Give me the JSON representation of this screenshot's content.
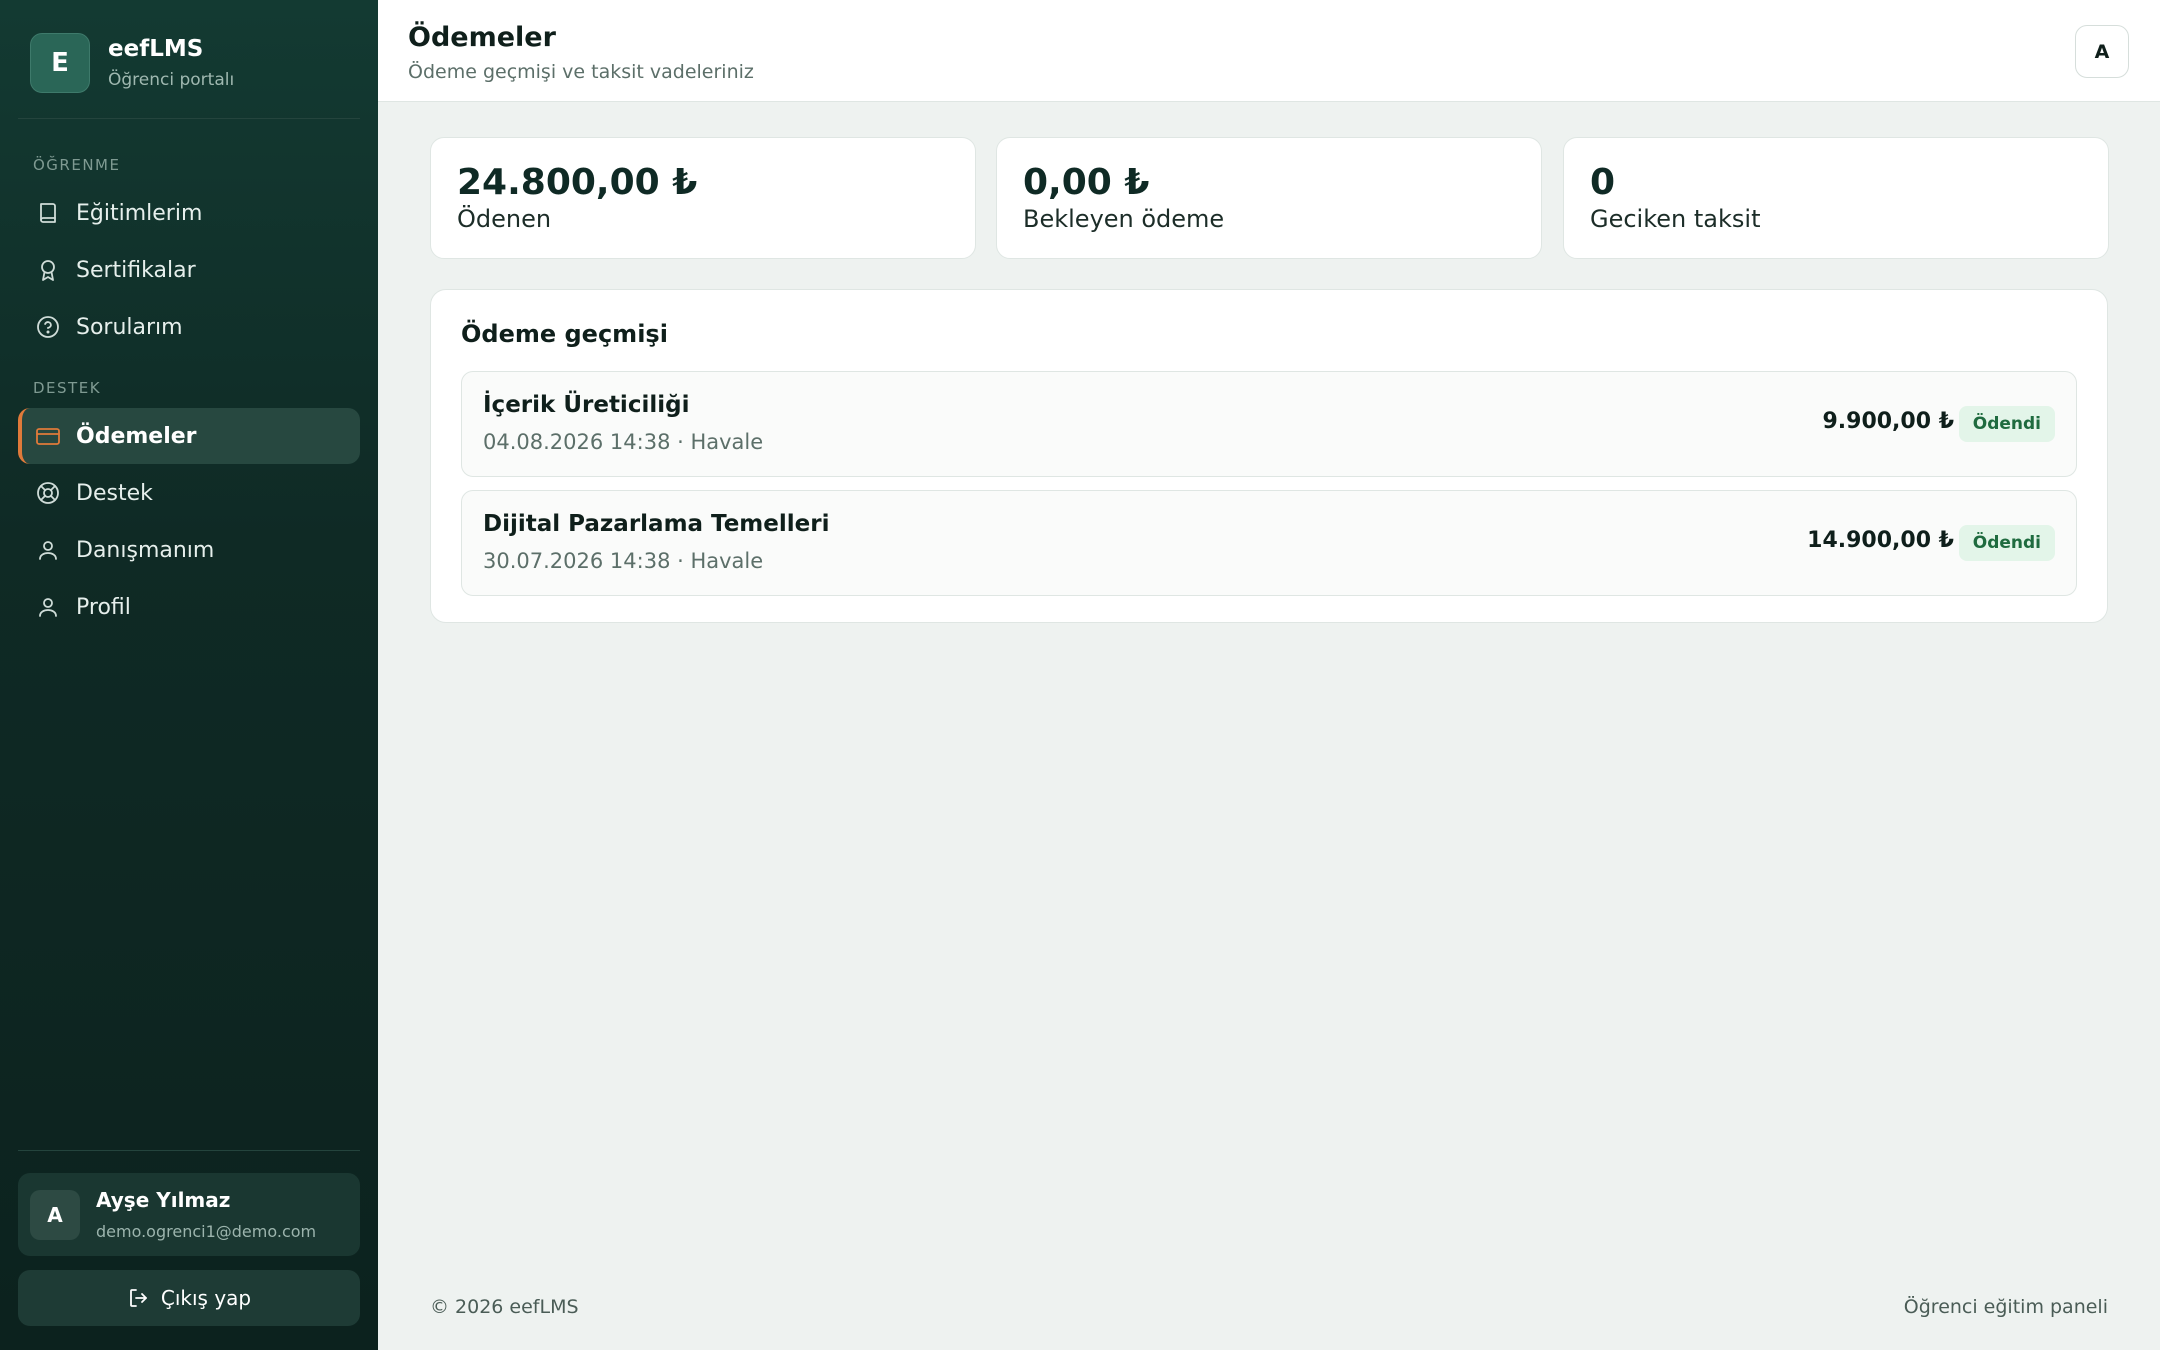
{
  "brand": {
    "logo_letter": "E",
    "name": "eefLMS",
    "subtitle": "Öğrenci portalı"
  },
  "sidebar": {
    "sections": [
      {
        "label": "ÖĞRENME"
      },
      {
        "label": "DESTEK"
      }
    ],
    "items": [
      {
        "label": "Eğitimlerim",
        "icon": "book-icon"
      },
      {
        "label": "Sertifikalar",
        "icon": "award-icon"
      },
      {
        "label": "Sorularım",
        "icon": "help-circle-icon"
      },
      {
        "label": "Ödemeler",
        "icon": "credit-card-icon",
        "active": true
      },
      {
        "label": "Destek",
        "icon": "support-icon"
      },
      {
        "label": "Danışmanım",
        "icon": "user-icon"
      },
      {
        "label": "Profil",
        "icon": "user-icon"
      }
    ],
    "user": {
      "initial": "A",
      "name": "Ayşe Yılmaz",
      "email": "demo.ogrenci1@demo.com"
    },
    "logout_label": "Çıkış yap"
  },
  "header": {
    "title": "Ödemeler",
    "subtitle": "Ödeme geçmişi ve taksit vadeleriniz",
    "avatar_initial": "A"
  },
  "stats": [
    {
      "value": "24.800,00 ₺",
      "label": "Ödenen"
    },
    {
      "value": "0,00 ₺",
      "label": "Bekleyen ödeme"
    },
    {
      "value": "0",
      "label": "Geciken taksit"
    }
  ],
  "history": {
    "title": "Ödeme geçmişi",
    "rows": [
      {
        "name": "İçerik Üreticiliği",
        "meta": "04.08.2026 14:38 · Havale",
        "amount": "9.900,00 ₺",
        "status": "Ödendi"
      },
      {
        "name": "Dijital Pazarlama Temelleri",
        "meta": "30.07.2026 14:38 · Havale",
        "amount": "14.900,00 ₺",
        "status": "Ödendi"
      }
    ]
  },
  "footer": {
    "copyright": "© 2026 eefLMS",
    "right_text": "Öğrenci eğitim paneli"
  },
  "colors": {
    "sidebar_bg": "#0f2a25",
    "accent": "#e07a3a",
    "status_bg": "#e3f5e9",
    "status_text": "#1f6b3f"
  }
}
